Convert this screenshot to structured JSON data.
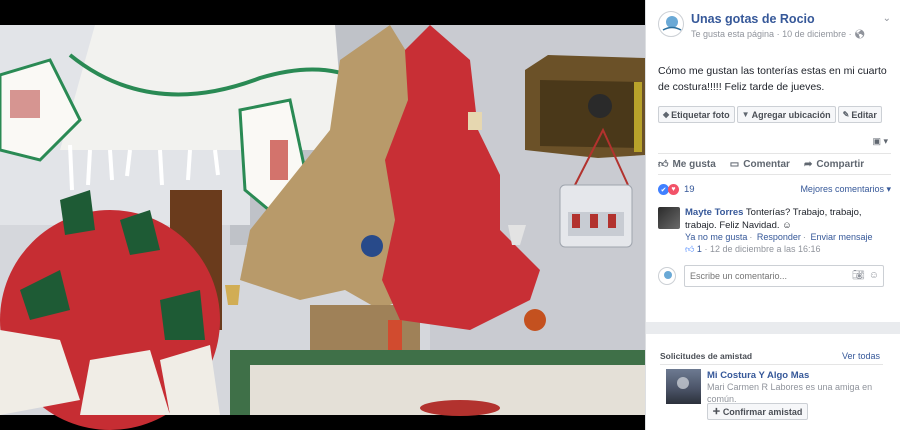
{
  "post": {
    "page_name": "Unas gotas de Rocio",
    "liked_label": "Te gusta esta página",
    "date": "10 de diciembre",
    "text": "Cómo me gustan las tonterías estas en mi cuarto de costura!!!!! Feliz tarde de jueves.",
    "tag_buttons": [
      "Etiquetar foto",
      "Agregar ubicación",
      "Editar"
    ]
  },
  "actions": {
    "like": "Me gusta",
    "comment": "Comentar",
    "share": "Compartir"
  },
  "reactions": {
    "count": "19",
    "sort_label": "Mejores comentarios"
  },
  "comment": {
    "author": "Mayte Torres",
    "text": "Tonterías? Trabajo, trabajo, trabajo. Feliz Navidad.",
    "unlike": "Ya no me gusta",
    "reply": "Responder",
    "send_message": "Enviar mensaje",
    "like_count": "1",
    "timestamp": "12 de diciembre a las 16:16"
  },
  "reply_box": {
    "placeholder": "Escribe un comentario..."
  },
  "friend_requests": {
    "title": "Solicitudes de amistad",
    "see_all": "Ver todas",
    "name": "Mi Costura Y Algo Mas",
    "mutual": "Mari Carmen R Labores es una amiga en común.",
    "confirm": "Confirmar amistad"
  },
  "colors": {
    "link": "#365899",
    "like_blue": "#4080ff",
    "love_red": "#f25268"
  },
  "icons": [
    "chevron-down-icon",
    "globe-icon",
    "tag-icon",
    "location-icon",
    "pencil-icon",
    "like-icon",
    "comment-icon",
    "share-icon",
    "camera-icon",
    "emoji-icon",
    "add-friend-icon"
  ]
}
